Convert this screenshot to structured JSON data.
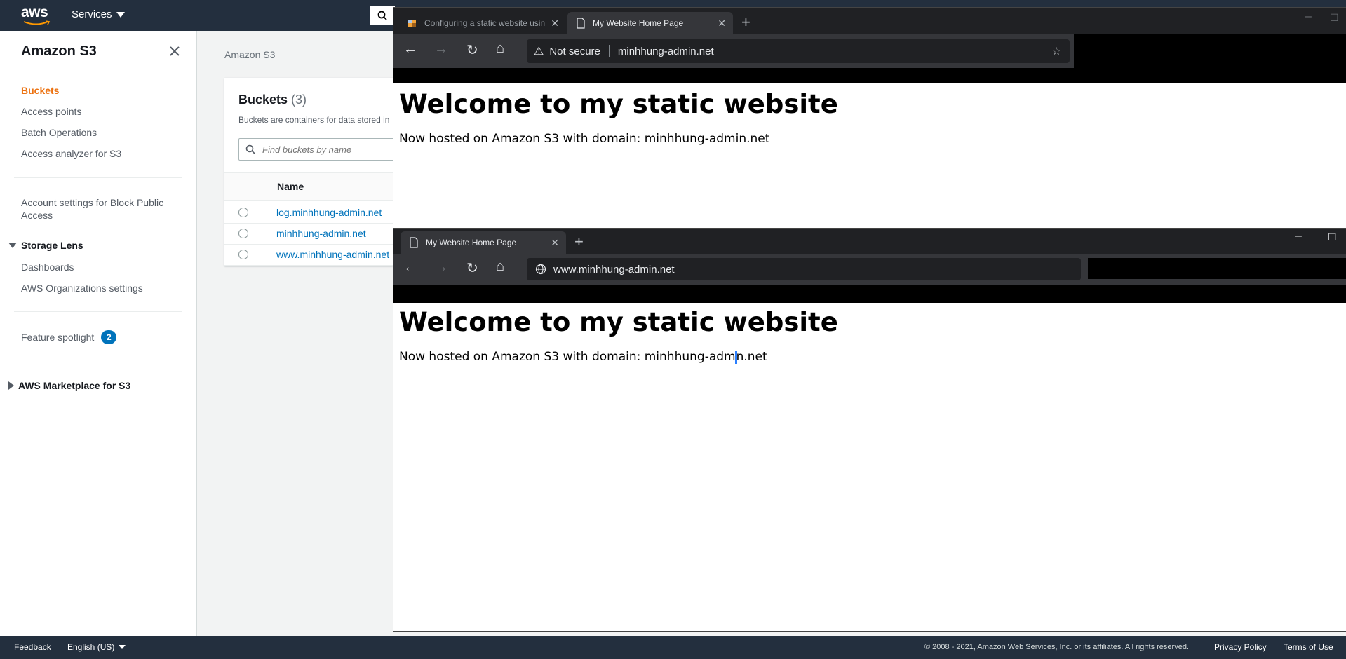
{
  "aws_nav": {
    "logo": "aws",
    "services_label": "Services"
  },
  "sidebar": {
    "title": "Amazon S3",
    "links": [
      {
        "label": "Buckets"
      },
      {
        "label": "Access points"
      },
      {
        "label": "Batch Operations"
      },
      {
        "label": "Access analyzer for S3"
      },
      {
        "label": "Account settings for Block Public Access"
      },
      {
        "label": "Dashboards"
      },
      {
        "label": "AWS Organizations settings"
      }
    ],
    "storage_lens": "Storage Lens",
    "feature_spotlight": "Feature spotlight",
    "feature_spotlight_count": "2",
    "marketplace": "AWS Marketplace for S3"
  },
  "main": {
    "breadcrumb": "Amazon S3",
    "buckets_title": "Buckets",
    "buckets_count": "(3)",
    "buckets_desc": "Buckets are containers for data stored in",
    "search_placeholder": "Find buckets by name",
    "column_name": "Name",
    "buckets": [
      "log.minhhung-admin.net",
      "minhhung-admin.net",
      "www.minhhung-admin.net"
    ]
  },
  "browser1": {
    "tabs": [
      "Configuring a static website usin",
      "My Website Home Page"
    ],
    "security_label": "Not secure",
    "url": "minhhung-admin.net",
    "heading": "Welcome to my static website",
    "text": "Now hosted on Amazon S3 with domain: minhhung-admin.net"
  },
  "browser2": {
    "tabs": [
      "My Website Home Page"
    ],
    "url": "www.minhhung-admin.net",
    "heading": "Welcome to my static website",
    "text_before_cursor": "Now hosted on Amazon S3 with domain: minhhung-adm",
    "text_after_cursor": "n.net"
  },
  "footer": {
    "feedback": "Feedback",
    "language": "English (US)",
    "copyright": "© 2008 - 2021, Amazon Web Services, Inc. or its affiliates. All rights reserved.",
    "privacy": "Privacy Policy",
    "terms": "Terms of Use"
  },
  "colors": {
    "aws_nav": "#232f3e",
    "accent": "#ec7211",
    "link": "#0073bb",
    "browser_dark": "#202124"
  }
}
